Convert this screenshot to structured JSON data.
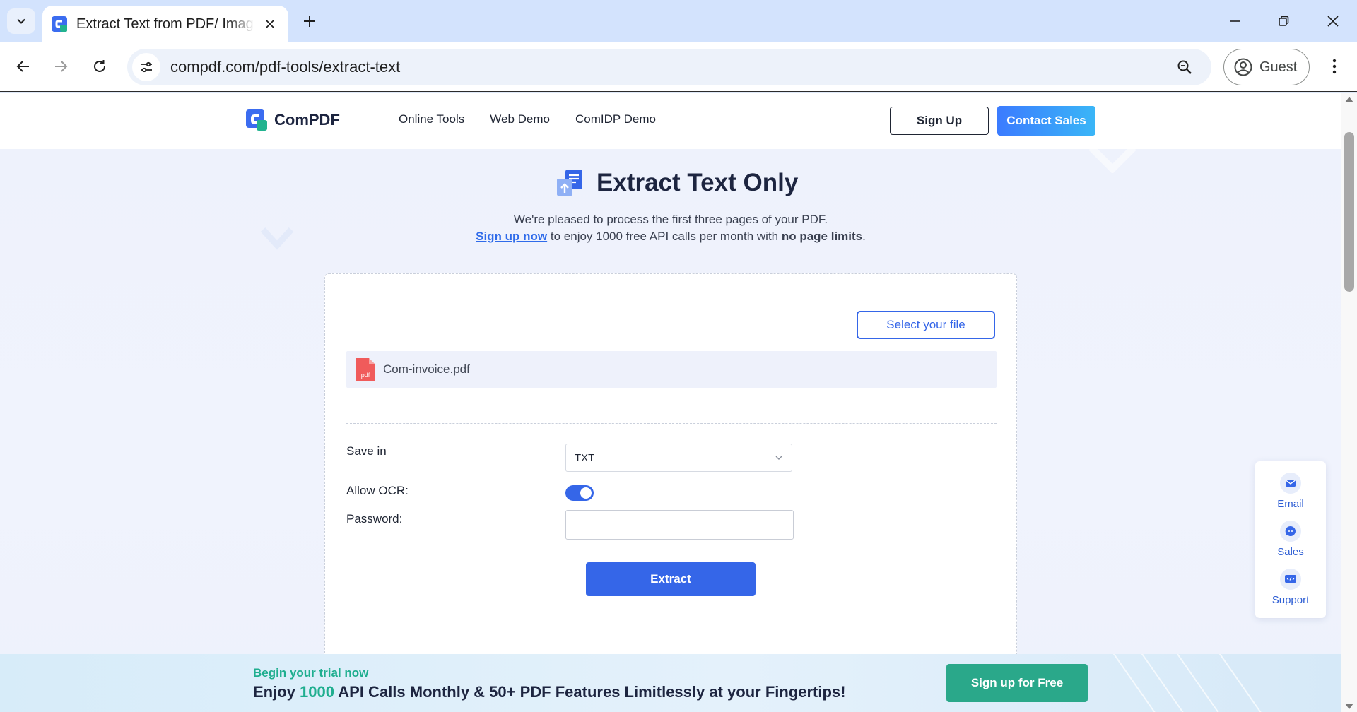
{
  "browser": {
    "tab": {
      "title": "Extract Text from PDF/ Image"
    },
    "address_bar": {
      "url": "compdf.com/pdf-tools/extract-text"
    },
    "profile": {
      "label": "Guest"
    }
  },
  "site": {
    "brand": "ComPDF",
    "nav": [
      "Online Tools",
      "Web Demo",
      "ComIDP Demo"
    ],
    "sign_up": "Sign Up",
    "contact_sales": "Contact Sales",
    "colors": {
      "primary": "#3566e8",
      "accent_green": "#2aa88a",
      "brand_dark": "#1d2540"
    }
  },
  "hero": {
    "title": "Extract Text Only",
    "line1": "We're pleased to process the first three pages of your PDF.",
    "line2_link": "Sign up now",
    "line2_text": " to enjoy 1000 free API calls per month with ",
    "line2_bold": "no page limits",
    "line2_end": "."
  },
  "tool": {
    "select_file": "Select your file",
    "file": {
      "name": "Com-invoice.pdf",
      "icon_text": "pdf"
    },
    "options": {
      "save_in_label": "Save in",
      "save_in_value": "TXT",
      "ocr_label": "Allow OCR:",
      "ocr_enabled": true,
      "password_label": "Password:",
      "password_value": ""
    },
    "extract": "Extract"
  },
  "support": {
    "items": [
      {
        "label": "Email",
        "icon": "mail-icon"
      },
      {
        "label": "Sales",
        "icon": "chat-icon"
      },
      {
        "label": "Support",
        "icon": "code-icon"
      }
    ]
  },
  "promo": {
    "kicker": "Begin your trial now",
    "headline_pre": "Enjoy ",
    "headline_num": "1000",
    "headline_post": " API Calls Monthly & 50+ PDF Features Limitlessly at your Fingertips!",
    "cta": "Sign up for Free"
  }
}
